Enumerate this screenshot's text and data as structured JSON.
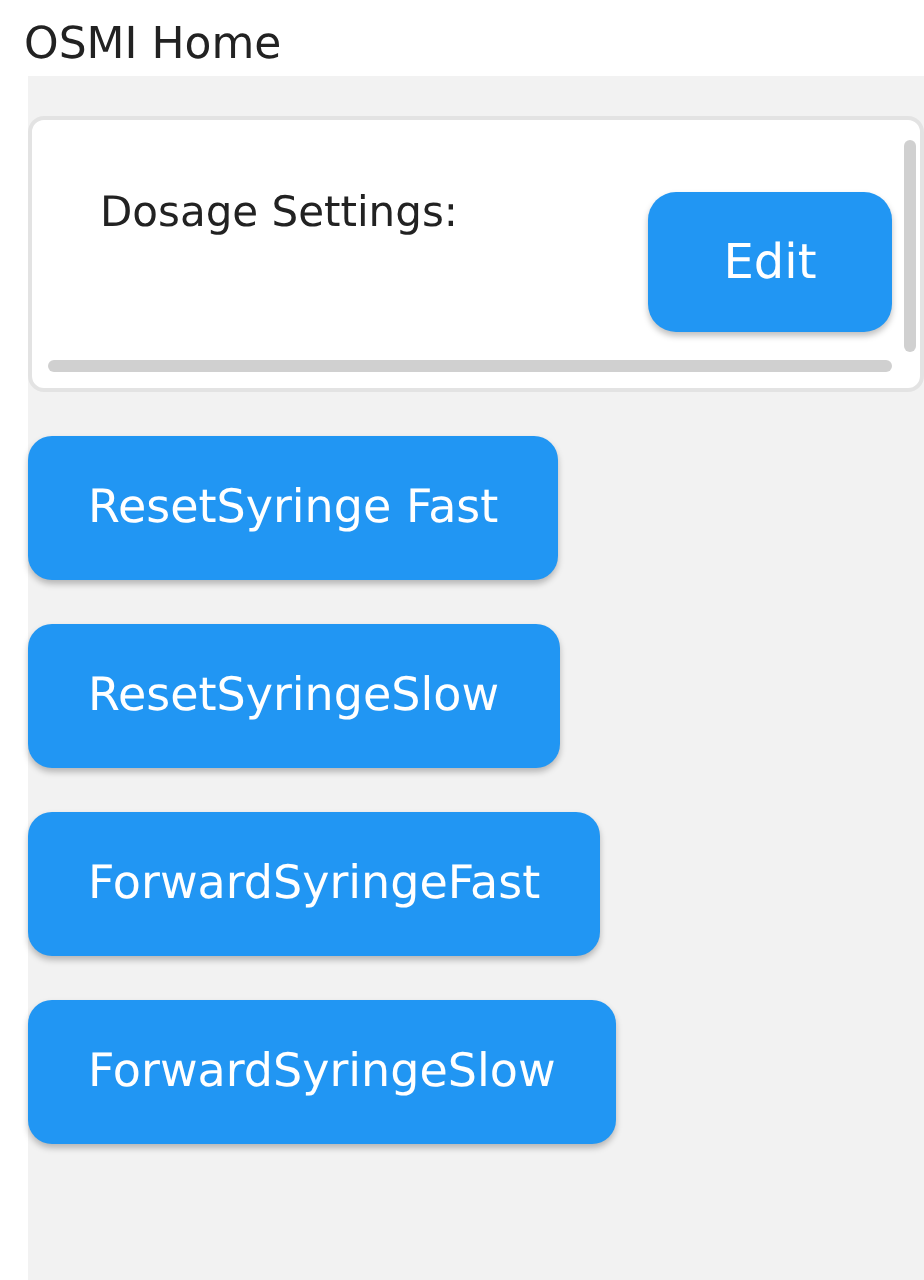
{
  "title": "OSMI Home",
  "dosage_card": {
    "label": "Dosage Settings:",
    "edit_button": "Edit"
  },
  "buttons": [
    "ResetSyringe Fast",
    "ResetSyringeSlow",
    "ForwardSyringeFast",
    "ForwardSyringeSlow"
  ]
}
